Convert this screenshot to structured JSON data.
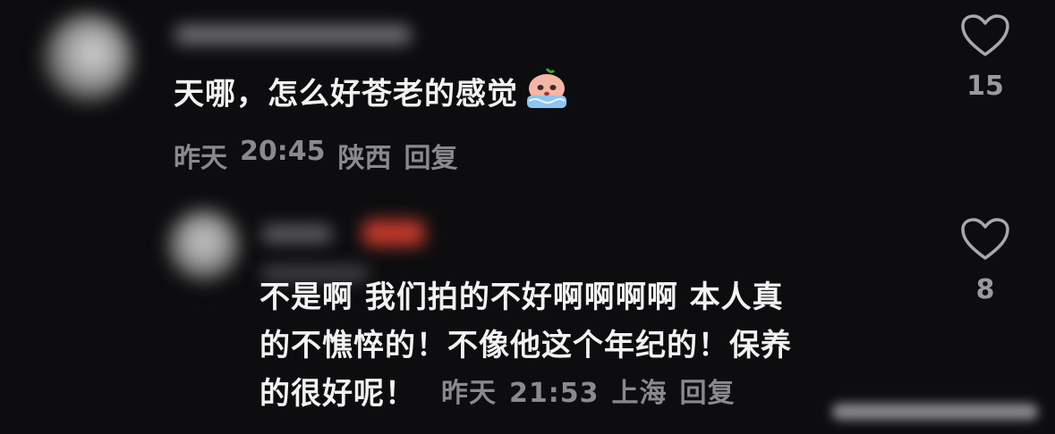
{
  "comments": [
    {
      "text": "天哪，怎么好苍老的感觉",
      "emoji": "crying-peach-emoji",
      "date": "昨天",
      "time": "20:45",
      "location": "陕西",
      "reply_label": "回复",
      "likes": "15"
    },
    {
      "lines": [
        "不是啊 我们拍的不好啊啊啊啊 本人真",
        "的不憔悴的！不像他这个年纪的！保养",
        "的很好呢！"
      ],
      "date": "昨天",
      "time": "21:53",
      "location": "上海",
      "reply_label": "回复",
      "likes": "8"
    }
  ],
  "icons": {
    "like": "heart-outline-icon"
  },
  "colors": {
    "background": "#0d0d0f",
    "text": "#f2f2f2",
    "meta": "#8a8a8e",
    "author_badge": "#c0392b"
  }
}
